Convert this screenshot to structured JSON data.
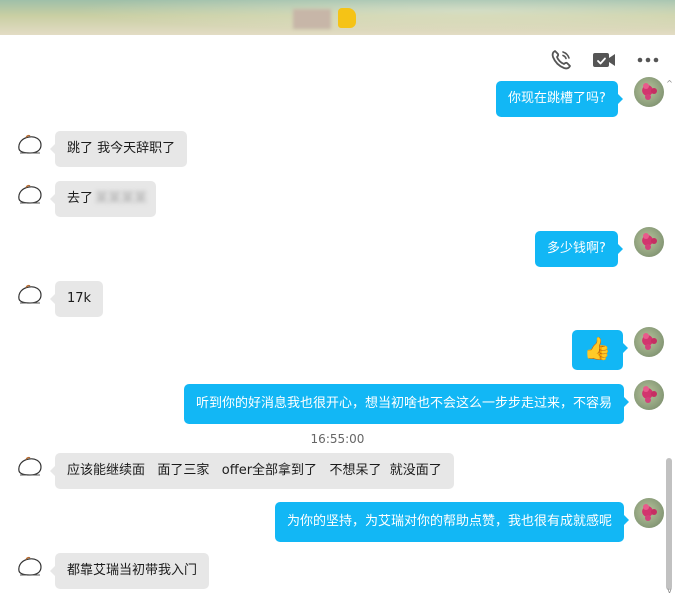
{
  "header": {
    "icons": [
      "phone-icon",
      "video-camera-icon",
      "more-icon"
    ]
  },
  "messages": [
    {
      "side": "right",
      "text": "你现在跳槽了吗?"
    },
    {
      "side": "left",
      "text": "跳了  我今天辞职了"
    },
    {
      "side": "left",
      "text": "去了",
      "redacted": true
    },
    {
      "side": "right",
      "text": "多少钱啊?"
    },
    {
      "side": "left",
      "text": "17k"
    },
    {
      "side": "right",
      "emoji": "👍"
    },
    {
      "side": "right",
      "text": "听到你的好消息我也很开心，想当初啥也不会这么一步步走过来，不容易"
    },
    {
      "timestamp": "16:55:00"
    },
    {
      "side": "left",
      "text": "应该能继续面   面了三家   offer全部拿到了   不想呆了  就没面了"
    },
    {
      "side": "right",
      "text": "为你的坚持，为艾瑞对你的帮助点赞，我也很有成就感呢"
    },
    {
      "side": "left",
      "text": "都靠艾瑞当初带我入门"
    }
  ],
  "colors": {
    "outgoing_bubble": "#12b7f5",
    "incoming_bubble": "#e7e7e7",
    "timestamp_text": "#666666"
  }
}
